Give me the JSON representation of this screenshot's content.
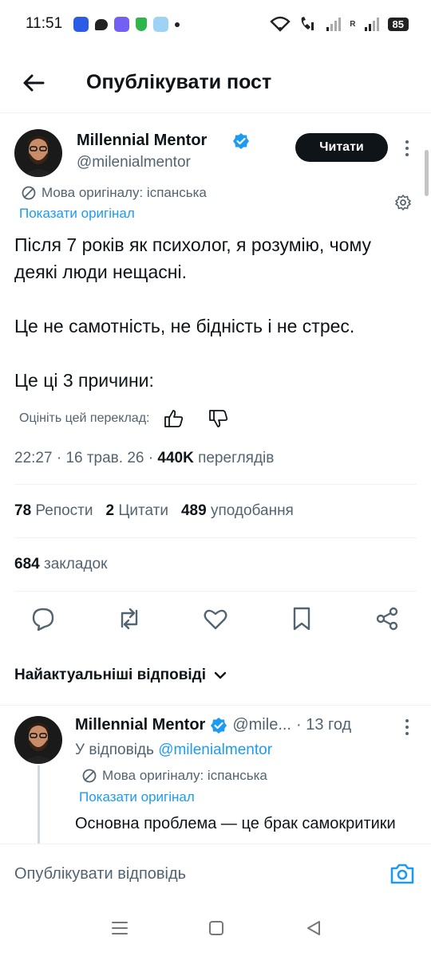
{
  "status": {
    "time": "11:51",
    "battery": "85",
    "signal_label": "R"
  },
  "header": {
    "title": "Опублікувати пост"
  },
  "post": {
    "author_name": "Millennial Mentor",
    "handle": "@milenialmentor",
    "follow_label": "Читати",
    "original_language": "Мова оригіналу: іспанська",
    "show_original": "Показати оригінал",
    "text": "Після 7 років як психолог, я розумію, чому деякі люди нещасні.\n\nЦе не самотність, не бідність і не стрес.\n\nЦе ці 3 причини:",
    "rate_translation": "Оцініть цей переклад:",
    "time": "22:27",
    "date": "16 трав. 26",
    "views_count": "440K",
    "views_label": "переглядів",
    "reposts_count": "78",
    "reposts_label": "Репости",
    "quotes_count": "2",
    "quotes_label": "Цитати",
    "likes_count": "489",
    "likes_label": "уподобання",
    "bookmarks_count": "684",
    "bookmarks_label": "закладок"
  },
  "replies": {
    "sort_label": "Найактуальніші відповіді",
    "items": [
      {
        "author_name": "Millennial Mentor",
        "handle": "@mile...",
        "time": "· 13 год",
        "reply_to_prefix": "У відповідь",
        "reply_to_handle": "@milenialmentor",
        "original_language": "Мова оригіналу: іспанська",
        "show_original": "Показати оригінал",
        "text": "Основна проблема — це брак самокритики"
      }
    ]
  },
  "compose": {
    "placeholder": "Опублікувати відповідь"
  },
  "colors": {
    "accent": "#1d9bf0",
    "text_primary": "#0f1419",
    "text_secondary": "#536471"
  },
  "icons": [
    "back-arrow-icon",
    "verified-badge-icon",
    "more-vertical-icon",
    "translate-icon",
    "settings-gear-icon",
    "thumbs-up-icon",
    "thumbs-down-icon",
    "reply-icon",
    "repost-icon",
    "like-icon",
    "bookmark-icon",
    "share-icon",
    "chevron-down-icon",
    "camera-icon",
    "menu-icon",
    "home-square-icon",
    "back-triangle-icon"
  ]
}
